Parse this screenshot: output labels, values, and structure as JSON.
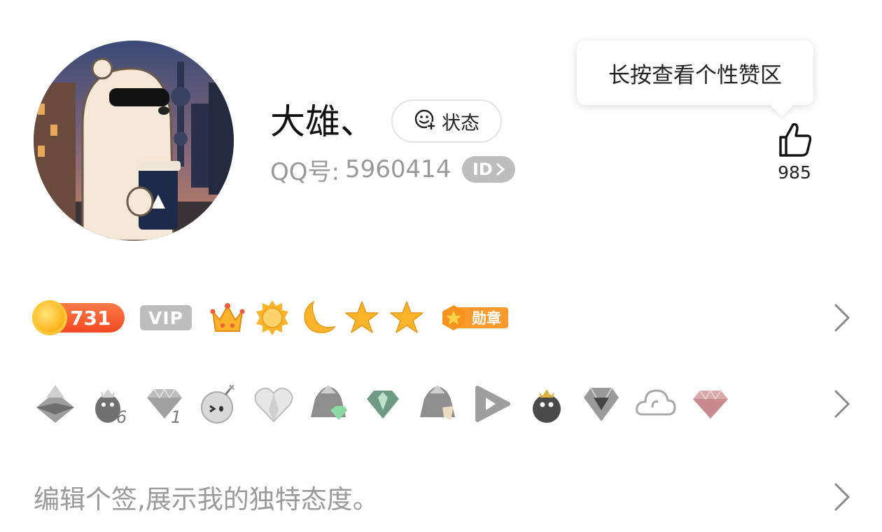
{
  "profile": {
    "nickname": "大雄、",
    "status_label": "状态",
    "qq_label": "QQ号:",
    "qq_number": "5960414",
    "id_badge": "ID"
  },
  "tooltip": {
    "text": "长按查看个性赞区"
  },
  "likes": {
    "count": "985",
    "icon": "thumbs-up-icon"
  },
  "levels": {
    "coin_value": "731",
    "vip_label": "VIP",
    "icons": [
      "crown-icon",
      "sun-icon",
      "moon-icon",
      "star-icon",
      "star-icon"
    ],
    "medal_label": "勋章"
  },
  "badges": {
    "icons": [
      "grey-mountain-badge",
      "penguin-6-badge",
      "diamond-1-badge",
      "bomb-face-badge",
      "heart-badge",
      "mountain-gem-badge",
      "green-diamond-badge",
      "mountain-flag-badge",
      "play-badge",
      "crown-penguin-badge",
      "silver-gem-badge",
      "cloud-badge",
      "pink-diamond-badge"
    ],
    "texts": {
      "penguin_number": "6",
      "diamond_number": "1"
    }
  },
  "signature": {
    "placeholder": "编辑个签,展示我的独特态度。"
  },
  "colors": {
    "accent_orange": "#f5a623",
    "coin_red": "#f14a23",
    "grey": "#bdbdbd",
    "text_grey": "#999999"
  }
}
